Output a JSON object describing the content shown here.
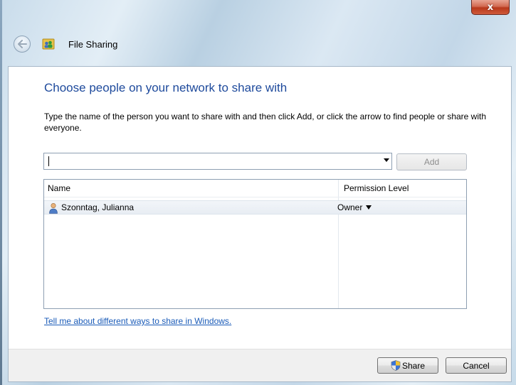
{
  "window": {
    "close_glyph": "x",
    "title": "File Sharing"
  },
  "main": {
    "heading": "Choose people on your network to share with",
    "instructions": "Type the name of the person you want to share with and then click Add, or click the arrow to find people or share with everyone.",
    "name_input_value": "",
    "add_label": "Add"
  },
  "table": {
    "columns": [
      "Name",
      "Permission Level"
    ],
    "rows": [
      {
        "name": "Szonntag, Julianna",
        "permission": "Owner"
      }
    ]
  },
  "link": {
    "text": "Tell me about different ways to share in Windows."
  },
  "footer": {
    "share_label": "Share",
    "cancel_label": "Cancel"
  },
  "icons": {
    "back": "back-arrow-icon",
    "title": "file-sharing-icon",
    "user": "user-icon",
    "shield": "uac-shield-icon"
  },
  "colors": {
    "heading": "#1e4a9c",
    "link": "#1a5bb8",
    "close_button": "#c44a2c"
  }
}
